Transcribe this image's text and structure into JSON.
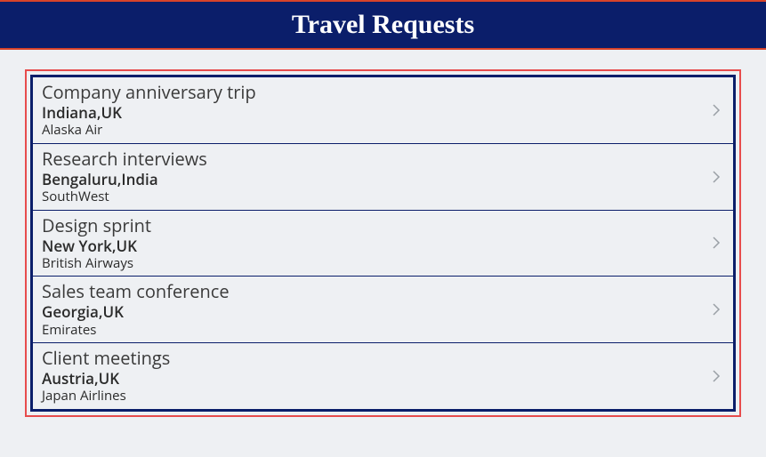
{
  "header": {
    "title": "Travel Requests"
  },
  "requests": [
    {
      "title": "Company anniversary trip",
      "destination": "Indiana,UK",
      "airline": "Alaska Air"
    },
    {
      "title": "Research interviews",
      "destination": "Bengaluru,India",
      "airline": "SouthWest"
    },
    {
      "title": "Design sprint",
      "destination": "New York,UK",
      "airline": "British Airways"
    },
    {
      "title": "Sales team conference",
      "destination": "Georgia,UK",
      "airline": "Emirates"
    },
    {
      "title": "Client meetings",
      "destination": "Austria,UK",
      "airline": "Japan Airlines"
    }
  ]
}
